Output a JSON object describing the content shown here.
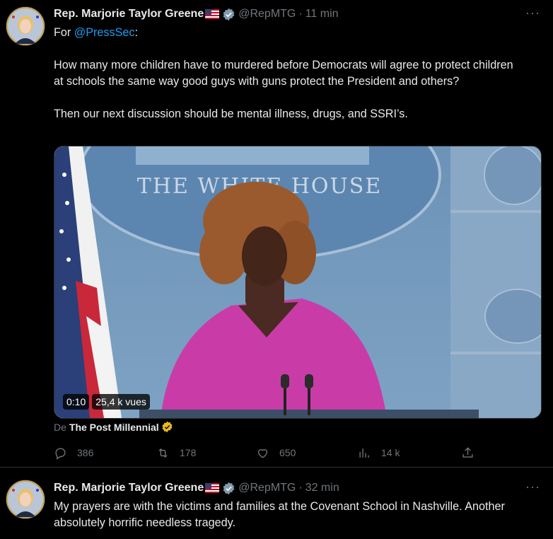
{
  "tweets": [
    {
      "author_name": "Rep. Marjorie Taylor Greene",
      "author_flag": "🇺🇸",
      "handle": "@RepMTG",
      "separator": "·",
      "time": "11 min",
      "more": "···",
      "text_prefix": "For ",
      "mention": "@PressSec",
      "text_suffix": ":",
      "paragraph_2": "How many more children have to murdered before Democrats will agree to protect children at schools the same way good guys with guns protect the President and others?",
      "paragraph_3": "Then our next discussion should be mental illness, drugs, and SSRI’s.",
      "media": {
        "duration": "0:10",
        "views": "25,4 k vues",
        "backdrop_text": "THE WHITE HOUSE"
      },
      "source_prefix": "De",
      "source_name": "The Post Millennial",
      "actions": {
        "replies": "386",
        "retweets": "178",
        "likes": "650",
        "views": "14 k"
      }
    },
    {
      "author_name": "Rep. Marjorie Taylor Greene",
      "author_flag": "🇺🇸",
      "handle": "@RepMTG",
      "separator": "·",
      "time": "32 min",
      "more": "···",
      "text": "My prayers are with the victims and families at the Covenant School in Nashville. Another absolutely horrific needless tragedy."
    }
  ],
  "colors": {
    "background": "#000000",
    "text": "#e7e9ea",
    "muted": "#71767b",
    "link": "#1d9bf0",
    "verified_gold": "#e8b923"
  }
}
